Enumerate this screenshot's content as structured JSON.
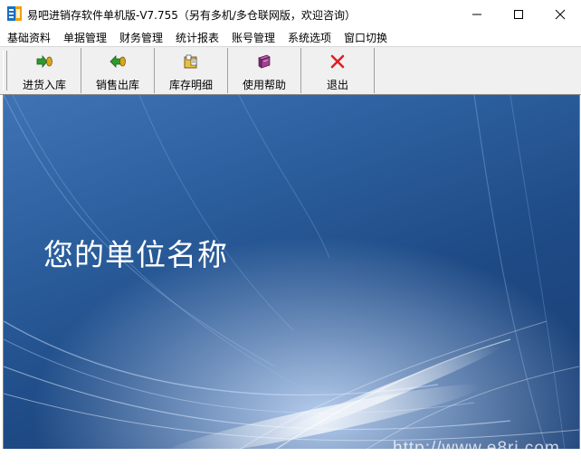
{
  "window": {
    "title": "易吧进销存软件单机版-V7.755（另有多机/多仓联网版，欢迎咨询）",
    "icon": "app-logo-icon"
  },
  "menu": [
    "基础资料",
    "单据管理",
    "财务管理",
    "统计报表",
    "账号管理",
    "系统选项",
    "窗口切换"
  ],
  "toolbar": [
    {
      "label": "进货入库",
      "icon": "stock-in-icon"
    },
    {
      "label": "销售出库",
      "icon": "stock-out-icon"
    },
    {
      "label": "库存明细",
      "icon": "inventory-icon"
    },
    {
      "label": "使用帮助",
      "icon": "help-book-icon"
    },
    {
      "label": "退出",
      "icon": "exit-x-icon"
    }
  ],
  "main": {
    "company_name": "您的单位名称",
    "url": "http://www.e8rj.com"
  },
  "colors": {
    "background_blue": "#2c5f9e",
    "exit_red": "#e02020"
  }
}
